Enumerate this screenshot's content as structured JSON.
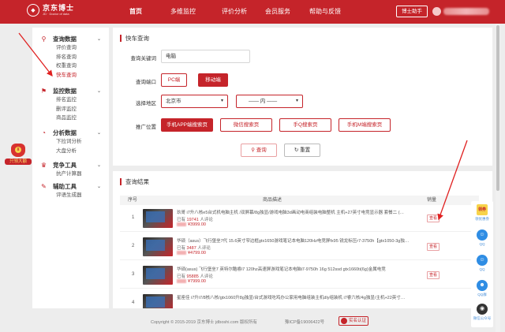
{
  "header": {
    "logo_cn": "京东博士",
    "logo_en": "JD · Doctor of data",
    "nav": [
      "首页",
      "多维监控",
      "评价分析",
      "会员服务",
      "帮助与反馈"
    ],
    "assistant_label": "博士助手"
  },
  "sidebar": {
    "groups": [
      {
        "title": "查询数据",
        "icon": "search-doc-icon",
        "items": [
          "评价查询",
          "排名查询",
          "权重查询",
          "快车查询"
        ]
      },
      {
        "title": "监控数据",
        "icon": "monitor-icon",
        "items": [
          "排名监控",
          "删评监控",
          "商品监控"
        ]
      },
      {
        "title": "分析数据",
        "icon": "analysis-icon",
        "items": [
          "下拉词分析",
          "大盘分析"
        ]
      },
      {
        "title": "竞争工具",
        "icon": "trophy-icon",
        "items": [
          "抗产计算器"
        ]
      },
      {
        "title": "辅助工具",
        "icon": "wrench-icon",
        "items": [
          "评语生成器"
        ]
      }
    ],
    "active_item": "快车查询"
  },
  "float_left": {
    "label": "只领大额"
  },
  "query": {
    "title": "快车查询",
    "keyword_label": "查询关键词",
    "keyword_value": "电脑",
    "port_label": "查询端口",
    "port_options": [
      "PC端",
      "移动端"
    ],
    "region_label": "选择地区",
    "province": "北京市",
    "city": "—— 内 ——",
    "position_label": "推广位置",
    "position_options": [
      "手机APP端搜索页",
      "微信搜索页",
      "手Q搜索页",
      "手机M端搜索页"
    ],
    "search_button": "查询",
    "reset_button": "重置"
  },
  "results": {
    "title": "查询结果",
    "columns": [
      "序号",
      "商品描述",
      "销量"
    ],
    "view_label": "查看",
    "rows": [
      {
        "index": "1",
        "desc": "玖哥 i7升八核e5台式机电脑主机 /双屏幕/8g独显/游戏电脑3d画动电商组装电脑整机 主机+27英寸电竞显示器 套餐二 (…",
        "count": "19741",
        "price": "¥3999.00"
      },
      {
        "index": "2",
        "desc": "华硕（asus）飞行堡垒7代 15.6英寸窄边框gtx1650游戏笔记本电脑120Hz电竞屏fx95 锐龙标压r7-3750h【gtx1050-3g独…",
        "count": "3487",
        "price": "¥4799.00"
      },
      {
        "index": "3",
        "desc": "华硕(asus) 飞行堡垒7 英特尔酷睿i7 120hz高速屏游戏笔记本电脑i7-9750h 16g 512ssd gtx1660ti(6g)金属电竞",
        "count": "95885",
        "price": "¥7999.00"
      },
      {
        "index": "4",
        "desc": "星座佳 i7升i7/8核八核/gtx1060升8g独显/台式游戏吃鸡办公家用电脑组装主机dly组装机 i7睿六核/4g独显/主机+22英寸…",
        "count": "",
        "price": ""
      }
    ],
    "count_prefix": "已有",
    "count_suffix": "人评论"
  },
  "footer": {
    "copyright": "Copyright © 2015-2019 京东博士 jdboshi.com 版权所有",
    "icp": "豫ICP备19006422号",
    "badge": "实名认证"
  },
  "right_bar": {
    "items": [
      {
        "icon": "gift-icon",
        "label": "领优惠券"
      },
      {
        "icon": "qq-icon",
        "label": "QQ"
      },
      {
        "icon": "qq-icon",
        "label": "QQ"
      },
      {
        "icon": "qq-group-icon",
        "label": "QQ群"
      },
      {
        "icon": "wechat-icon",
        "label": "微信公众号"
      }
    ],
    "gift_text": "领券"
  },
  "colors": {
    "brand": "#c5242a",
    "link": "#2f8de4"
  }
}
